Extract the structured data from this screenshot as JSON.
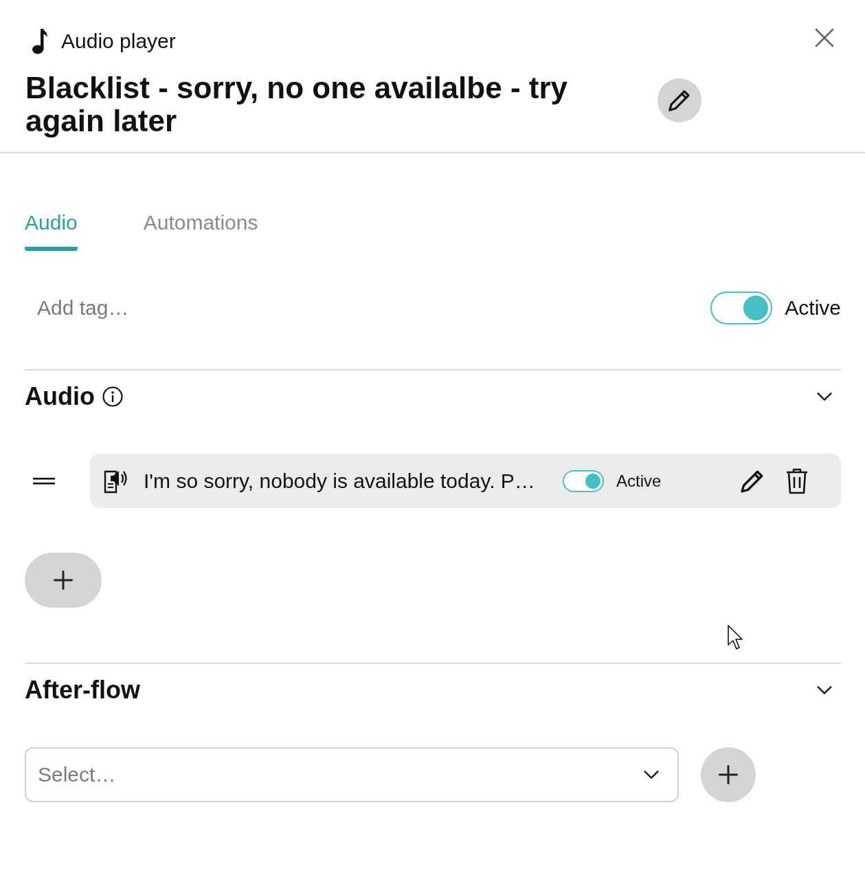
{
  "header": {
    "label": "Audio player",
    "title": "Blacklist - sorry, no one availalbe - try again later"
  },
  "tabs": [
    {
      "label": "Audio",
      "selected": true
    },
    {
      "label": "Automations",
      "selected": false
    }
  ],
  "tag_field": {
    "placeholder": "Add tag…"
  },
  "status_toggle": {
    "on": true,
    "label": "Active"
  },
  "audio_section": {
    "title": "Audio",
    "expanded": true,
    "items": [
      {
        "text": "I'm so sorry, nobody is available today. P…",
        "active": true,
        "status_label": "Active"
      }
    ]
  },
  "after_flow": {
    "title": "After-flow",
    "expanded": true,
    "select": {
      "placeholder": "Select…"
    }
  }
}
